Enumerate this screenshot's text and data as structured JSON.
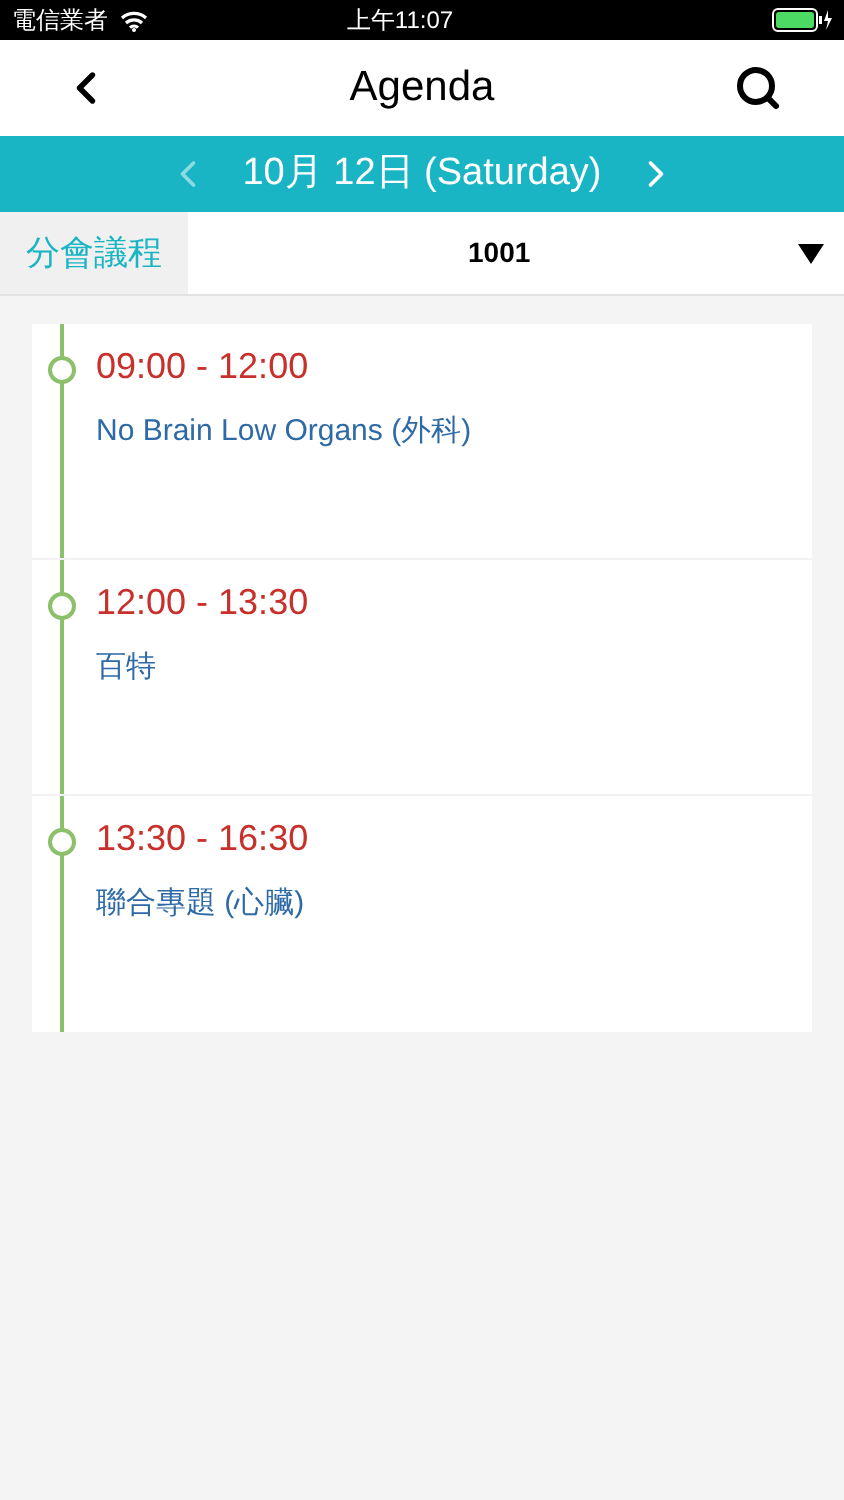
{
  "status_bar": {
    "carrier": "電信業者",
    "time": "上午11:07"
  },
  "header": {
    "title": "Agenda"
  },
  "date_nav": {
    "label": "10月 12日 (Saturday)",
    "prev_disabled": true,
    "next_disabled": false
  },
  "filter": {
    "label": "分會議程",
    "value": "1001"
  },
  "sessions": [
    {
      "time": "09:00 - 12:00",
      "title": "No Brain Low Organs (外科)"
    },
    {
      "time": "12:00 - 13:30",
      "title": "百特"
    },
    {
      "time": "13:30 - 16:30",
      "title": "聯合專題 (心臟)"
    }
  ]
}
